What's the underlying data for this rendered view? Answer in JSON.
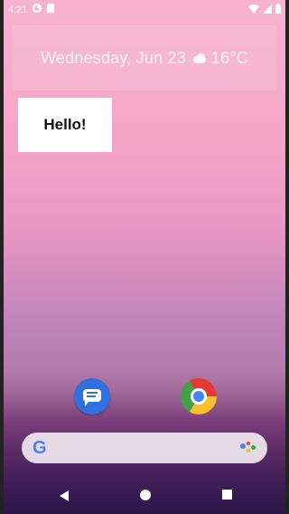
{
  "status_bar": {
    "time": "4:21",
    "left_icons": [
      "data-saver-icon",
      "sd-card-icon"
    ],
    "right_icons": [
      "wifi-icon",
      "signal-icon",
      "battery-icon"
    ]
  },
  "weather_widget": {
    "text_date": "Wednesday, Jun 23",
    "weather_icon": "cloud-icon",
    "temperature": "16°C"
  },
  "app_widget": {
    "text": "Hello!"
  },
  "dock": {
    "apps": [
      {
        "name": "Messages",
        "icon": "messages-icon",
        "color": "#2f6fde"
      },
      {
        "name": "Chrome",
        "icon": "chrome-icon"
      }
    ]
  },
  "search_bar": {
    "logo": "G",
    "assistant_icon": "google-assistant-icon"
  },
  "nav_bar": {
    "buttons": [
      "back",
      "home",
      "recents"
    ]
  }
}
